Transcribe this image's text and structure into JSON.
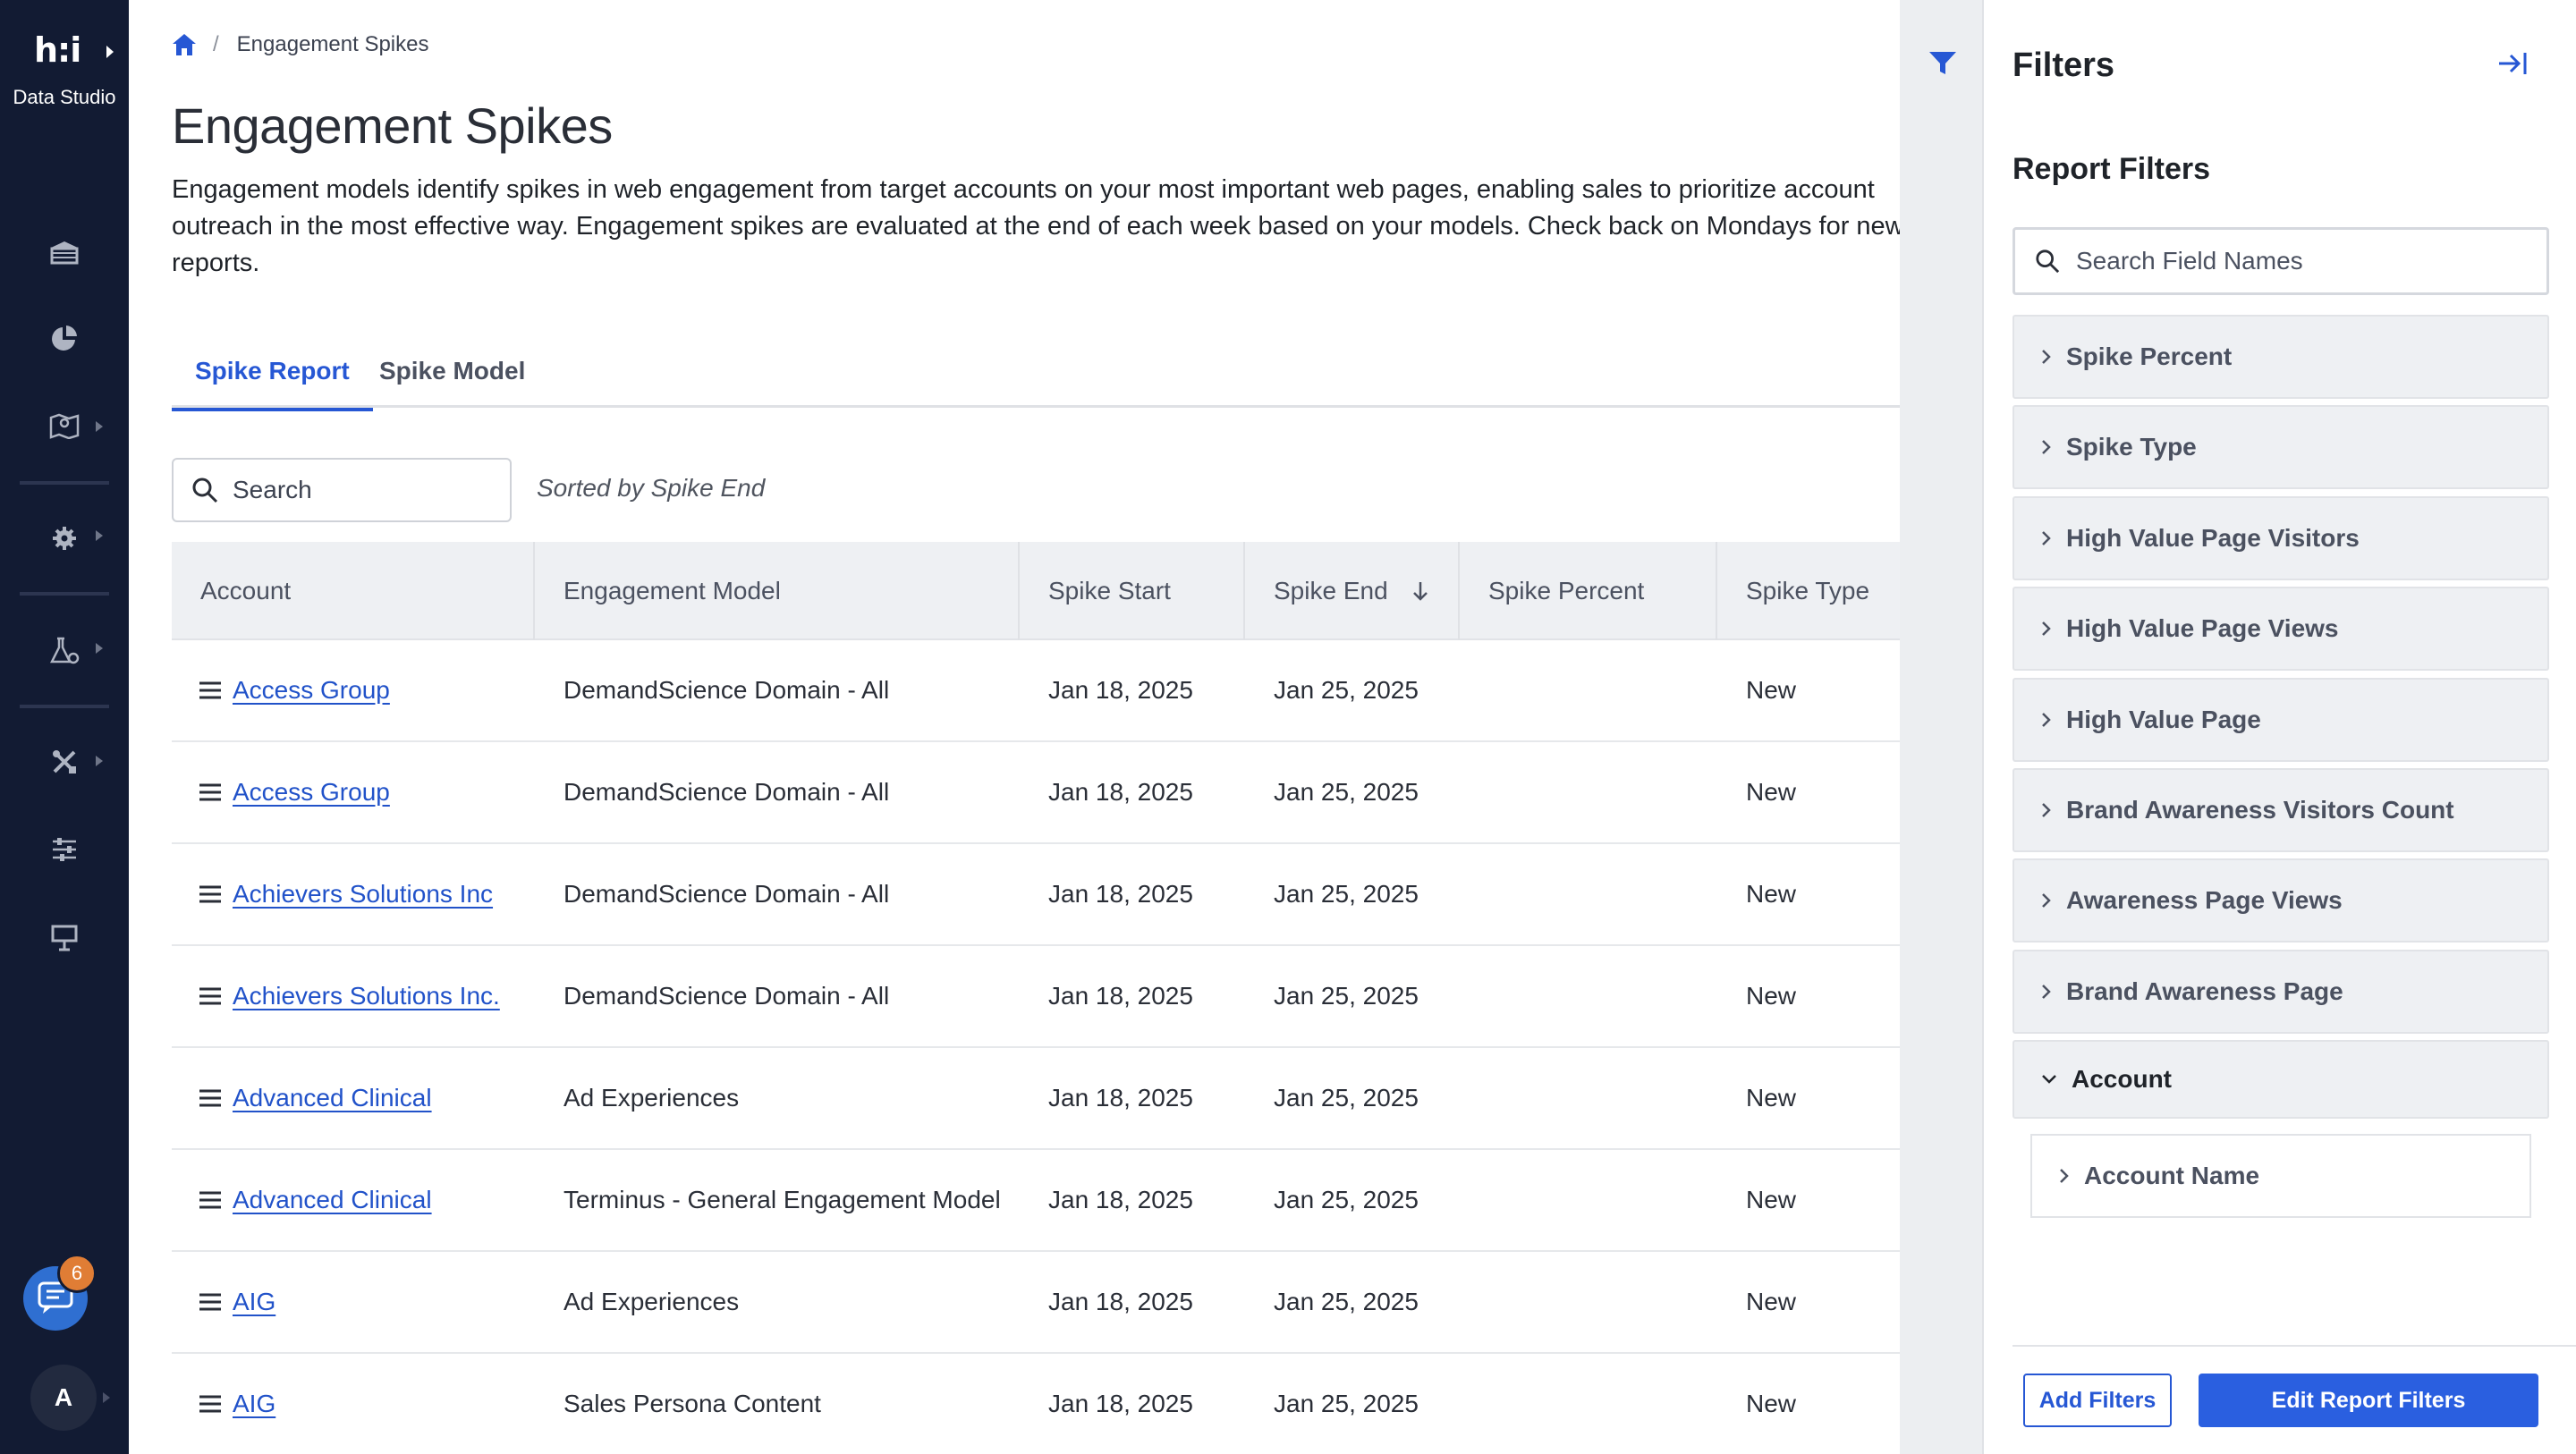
{
  "app": {
    "logo_text": "h:i",
    "product_name": "Data Studio",
    "chat_badge_count": "6",
    "avatar_initial": "A"
  },
  "nav_icons": [
    "building-icon",
    "pie-chart-icon",
    "map-icon",
    "gear-icon",
    "lab-flask-icon",
    "tools-icon",
    "sliders-icon",
    "presentation-icon"
  ],
  "breadcrumb": {
    "current": "Engagement Spikes"
  },
  "page": {
    "title": "Engagement Spikes",
    "description": "Engagement models identify spikes in web engagement from target accounts on your most important web pages, enabling sales to prioritize account outreach in the most effective way. Engagement spikes are evaluated at the end of each week based on your models. Check back on Mondays for new reports."
  },
  "tabs": [
    {
      "label": "Spike Report",
      "active": true
    },
    {
      "label": "Spike Model",
      "active": false
    }
  ],
  "search": {
    "placeholder": "Search"
  },
  "sorted_label": "Sorted by Spike End",
  "table": {
    "columns": [
      "Account",
      "Engagement Model",
      "Spike Start",
      "Spike End",
      "Spike Percent",
      "Spike Type"
    ],
    "rows": [
      {
        "account": "Access Group",
        "model": "DemandScience Domain - All",
        "start": "Jan 18, 2025",
        "end": "Jan 25, 2025",
        "percent": "",
        "type": "New"
      },
      {
        "account": "Access Group",
        "model": "DemandScience Domain - All",
        "start": "Jan 18, 2025",
        "end": "Jan 25, 2025",
        "percent": "",
        "type": "New"
      },
      {
        "account": "Achievers Solutions Inc",
        "model": "DemandScience Domain - All",
        "start": "Jan 18, 2025",
        "end": "Jan 25, 2025",
        "percent": "",
        "type": "New"
      },
      {
        "account": "Achievers Solutions Inc.",
        "model": "DemandScience Domain - All",
        "start": "Jan 18, 2025",
        "end": "Jan 25, 2025",
        "percent": "",
        "type": "New"
      },
      {
        "account": "Advanced Clinical",
        "model": "Ad Experiences",
        "start": "Jan 18, 2025",
        "end": "Jan 25, 2025",
        "percent": "",
        "type": "New"
      },
      {
        "account": "Advanced Clinical",
        "model": "Terminus - General Engagement Model",
        "start": "Jan 18, 2025",
        "end": "Jan 25, 2025",
        "percent": "",
        "type": "New"
      },
      {
        "account": "AIG",
        "model": "Ad Experiences",
        "start": "Jan 18, 2025",
        "end": "Jan 25, 2025",
        "percent": "",
        "type": "New"
      },
      {
        "account": "AIG",
        "model": "Sales Persona Content",
        "start": "Jan 18, 2025",
        "end": "Jan 25, 2025",
        "percent": "",
        "type": "New"
      }
    ]
  },
  "filters_panel": {
    "title": "Filters",
    "section_title": "Report Filters",
    "search_placeholder": "Search Field Names",
    "items": [
      {
        "label": "Spike Percent",
        "expanded": false
      },
      {
        "label": "Spike Type",
        "expanded": false
      },
      {
        "label": "High Value Page Visitors",
        "expanded": false
      },
      {
        "label": "High Value Page Views",
        "expanded": false
      },
      {
        "label": "High Value Page",
        "expanded": false
      },
      {
        "label": "Brand Awareness Visitors Count",
        "expanded": false
      },
      {
        "label": "Awareness Page Views",
        "expanded": false
      },
      {
        "label": "Brand Awareness Page",
        "expanded": false
      },
      {
        "label": "Account",
        "expanded": true
      }
    ],
    "sub_items": [
      {
        "label": "Account Name"
      }
    ],
    "add_filters_label": "Add Filters",
    "edit_filters_label": "Edit Report Filters"
  },
  "colors": {
    "nav_bg": "#121b33",
    "accent": "#2657d4",
    "badge": "#e07d35"
  }
}
